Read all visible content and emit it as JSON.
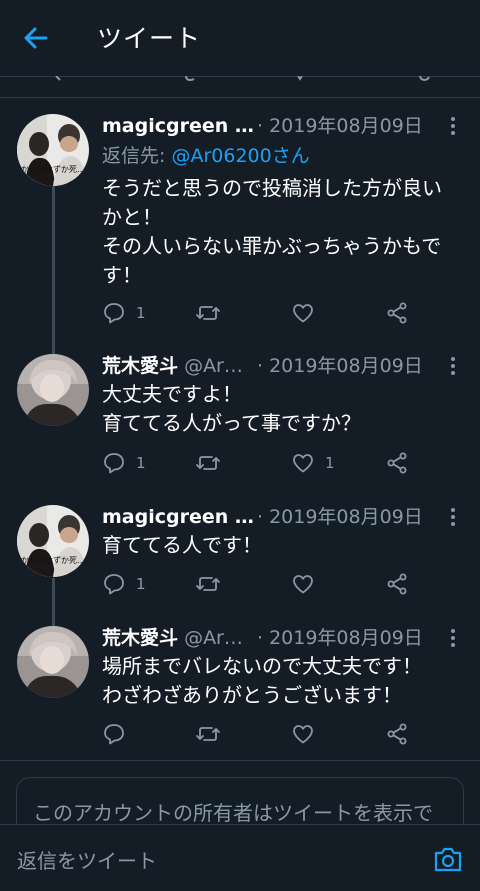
{
  "header": {
    "title": "ツイート",
    "back_icon": "arrow-left-icon",
    "accent": "#1da1f2"
  },
  "colors": {
    "background": "#141d26",
    "muted_text": "#8899a6",
    "divider": "#2f3b47",
    "link": "#1da1f2"
  },
  "tweets": [
    {
      "name": "magicgreen …",
      "handle": "",
      "date": "· 2019年08月09日",
      "reply_label": "返信先: ",
      "reply_to": "@Ar06200さん",
      "lines": [
        "そうだと思うので投稿消した方が良い",
        "かと！",
        "その人いらない罪かぶっちゃうかもで",
        "す！"
      ],
      "replies": "1",
      "retweets": "",
      "likes": ""
    },
    {
      "name": "荒木愛斗",
      "handle": "@Ar…",
      "date": "· 2019年08月09日",
      "lines": [
        "大丈夫ですよ！",
        "育ててる人がって事ですか？"
      ],
      "replies": "1",
      "retweets": "",
      "likes": "1"
    },
    {
      "name": "magicgreen …",
      "handle": "",
      "date": "· 2019年08月09日",
      "lines": [
        "育ててる人です！"
      ],
      "replies": "1",
      "retweets": "",
      "likes": ""
    },
    {
      "name": "荒木愛斗",
      "handle": "@Ar…",
      "date": "· 2019年08月09日",
      "lines": [
        "場所までバレないので大丈夫です！",
        "わざわざありがとうございます！"
      ],
      "replies": "",
      "retweets": "",
      "likes": ""
    }
  ],
  "avatar_caption": "かしいはずか死…",
  "notice": {
    "text": "このアカウントの所有者はツイートを表示で"
  },
  "reply_bar": {
    "placeholder": "返信をツイート",
    "camera_icon": "camera-icon"
  }
}
